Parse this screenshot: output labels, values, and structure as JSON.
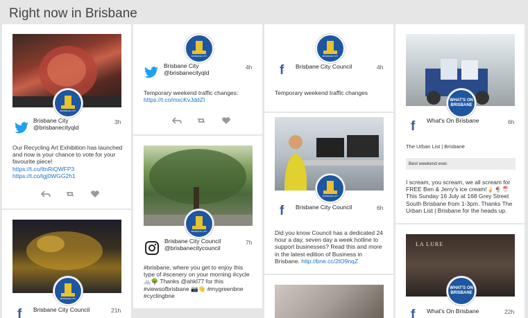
{
  "page_title": "Right now in Brisbane",
  "posts": {
    "p1": {
      "name": "Brisbane City",
      "handle": "@brisbanecityqld",
      "time": "3h",
      "text": "Our Recycling Art Exhibition has launched and now is your chance to vote for your favourite piece!",
      "link1": "https://t.co/ItnRiQWFP3",
      "link2": "https://t.co/tgj0WGG2h1"
    },
    "p2": {
      "name": "Brisbane City Council",
      "time": "21h"
    },
    "p3": {
      "name": "Brisbane City",
      "handle": "@brisbanecityqld",
      "time": "4h",
      "text": "Temporary weekend traffic changes:",
      "link": "https://t.co/mxcKvJddZI"
    },
    "p4": {
      "name": "Brisbane City Council",
      "handle": "@brisbanecitycouncil",
      "time": "7h",
      "text": "#brisbane, where you get to enjoy this type of #scenery on your morning #cycle 🚲🌳 Thanks @ahkl77 for this #viewsofbrisbane 📷👋 #mygreenbne #cyclingbne"
    },
    "p5": {
      "name": "Brisbane City Council",
      "time": "4h",
      "text": "Temporary weekend traffic changes"
    },
    "p6": {
      "name": "Brisbane City Council",
      "time": "6h",
      "text": "Did you know Council has a dedicated 24 hour a day, seven day a week hotline to support businesses? Read this and more in the latest edition of Business in Brisbane.",
      "link": "http://bne.cc/2tO9nqZ"
    },
    "p7": {
      "name": "What's On Brisbane",
      "time": "6h",
      "subtitle": "The Urban List | Brisbane",
      "quote": "Best weekend ever.",
      "text": "I scream, you scream, we all scream for FREE Ben & Jerry's ice cream!🍦🍨🍧 This Sunday 16 July at 168 Grey Street South Brisbane from 1-3pm. Thanks The Urban List | Brisbane for the heads up."
    },
    "p8": {
      "name": "What's On Brisbane",
      "time": "22h",
      "storefront": "LA LURE"
    }
  },
  "avatars": {
    "council_caption": "BRISBANE CITY",
    "whatson_line1": "WHAT'S ON",
    "whatson_line2": "BRISBANE"
  },
  "icons": {
    "twitter": "twitter-bird-icon",
    "facebook": "facebook-f-icon",
    "instagram": "instagram-camera-icon",
    "reply": "reply-icon",
    "retweet": "retweet-icon",
    "like": "heart-icon"
  },
  "colors": {
    "twitter": "#1da1f2",
    "facebook": "#3b5998",
    "link": "#1a6fc4",
    "avatar_blue": "#1e56a0",
    "gold": "#e8c230"
  }
}
